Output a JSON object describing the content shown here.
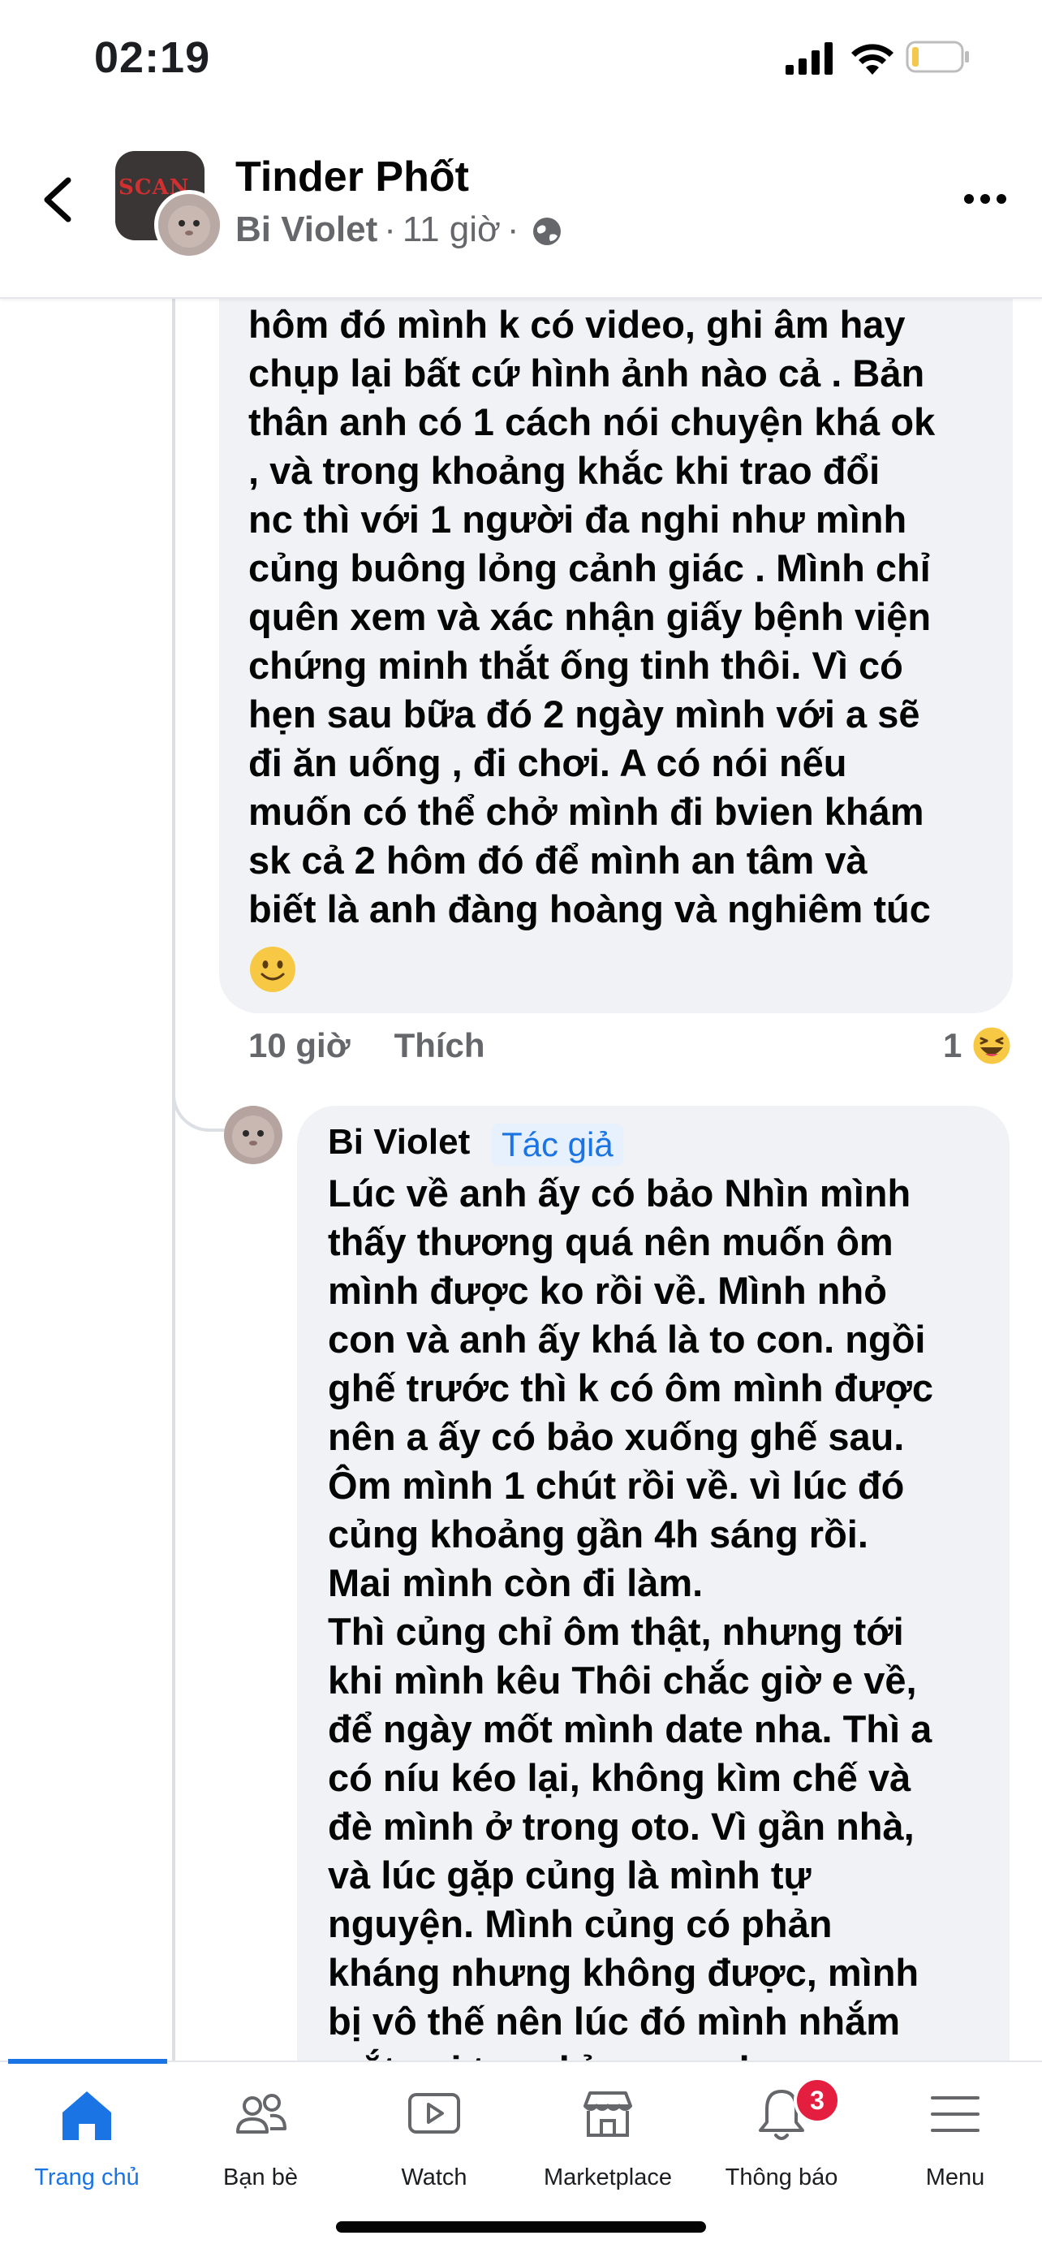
{
  "status_bar": {
    "time": "02:19"
  },
  "header": {
    "title": "Tinder Phốt",
    "author": "Bi Violet",
    "time": "11 giờ",
    "group_avatar_text": "SCAN"
  },
  "comment1": {
    "text": "hôm đó mình k có video, ghi âm hay\nchụp lại bất cứ hình ảnh nào cả . Bản\nthân anh có 1 cách nói chuyện khá ok\n, và trong khoảng khắc khi trao đổi\nnc thì với 1 người đa nghi như mình\ncủng buông lỏng cảnh giác . Mình chỉ\nquên xem và xác nhận giấy bệnh viện\nchứng minh thắt ống tinh thôi. Vì có\nhẹn sau bữa đó 2 ngày mình với a sẽ\nđi ăn uống , đi chơi. A có nói nếu\nmuốn có thể chở mình đi bvien khám\nsk cả 2 hôm đó để mình an tâm và\nbiết là anh đàng hoàng và nghiêm túc",
    "time": "10 giờ",
    "like_label": "Thích",
    "reaction_count": "1"
  },
  "comment2": {
    "author": "Bi Violet",
    "badge": "Tác giả",
    "text": "Lúc về anh ấy có bảo Nhìn mình\nthấy thương quá nên muốn ôm\nmình được ko rồi về. Mình nhỏ\ncon và anh ấy khá là to con. ngồi\nghế trước thì k có ôm mình được\nnên a ấy có bảo xuống ghế sau.\nÔm mình 1 chút rồi về. vì lúc đó\ncủng khoảng gần 4h sáng rồi.\nMai mình còn đi làm.\nThì củng chỉ ôm thật, nhưng tới\nkhi mình kêu Thôi chắc giờ e về,\nđể ngày mốt mình date nha. Thì a\ncó níu kéo lại, không kìm chế và\nđè mình ở trong oto. Vì gần nhà,\nvà lúc gặp củng là mình tự\nnguyện. Mình củng có phản\nkháng nhưng không được, mình\nbị vô thế nên lúc đó mình nhắm\nmắt xui tay chỉ mong cho xong"
  },
  "bottom_nav": {
    "items": [
      {
        "label": "Trang chủ",
        "icon": "home-icon",
        "active": true
      },
      {
        "label": "Bạn bè",
        "icon": "friends-icon"
      },
      {
        "label": "Watch",
        "icon": "watch-icon"
      },
      {
        "label": "Marketplace",
        "icon": "marketplace-icon"
      },
      {
        "label": "Thông báo",
        "icon": "bell-icon",
        "badge": "3"
      },
      {
        "label": "Menu",
        "icon": "menu-icon"
      }
    ]
  },
  "colors": {
    "accent": "#1b74e4",
    "bubble": "#f0f2f5",
    "badge_red": "#e41e3f",
    "muted": "#65676b"
  }
}
